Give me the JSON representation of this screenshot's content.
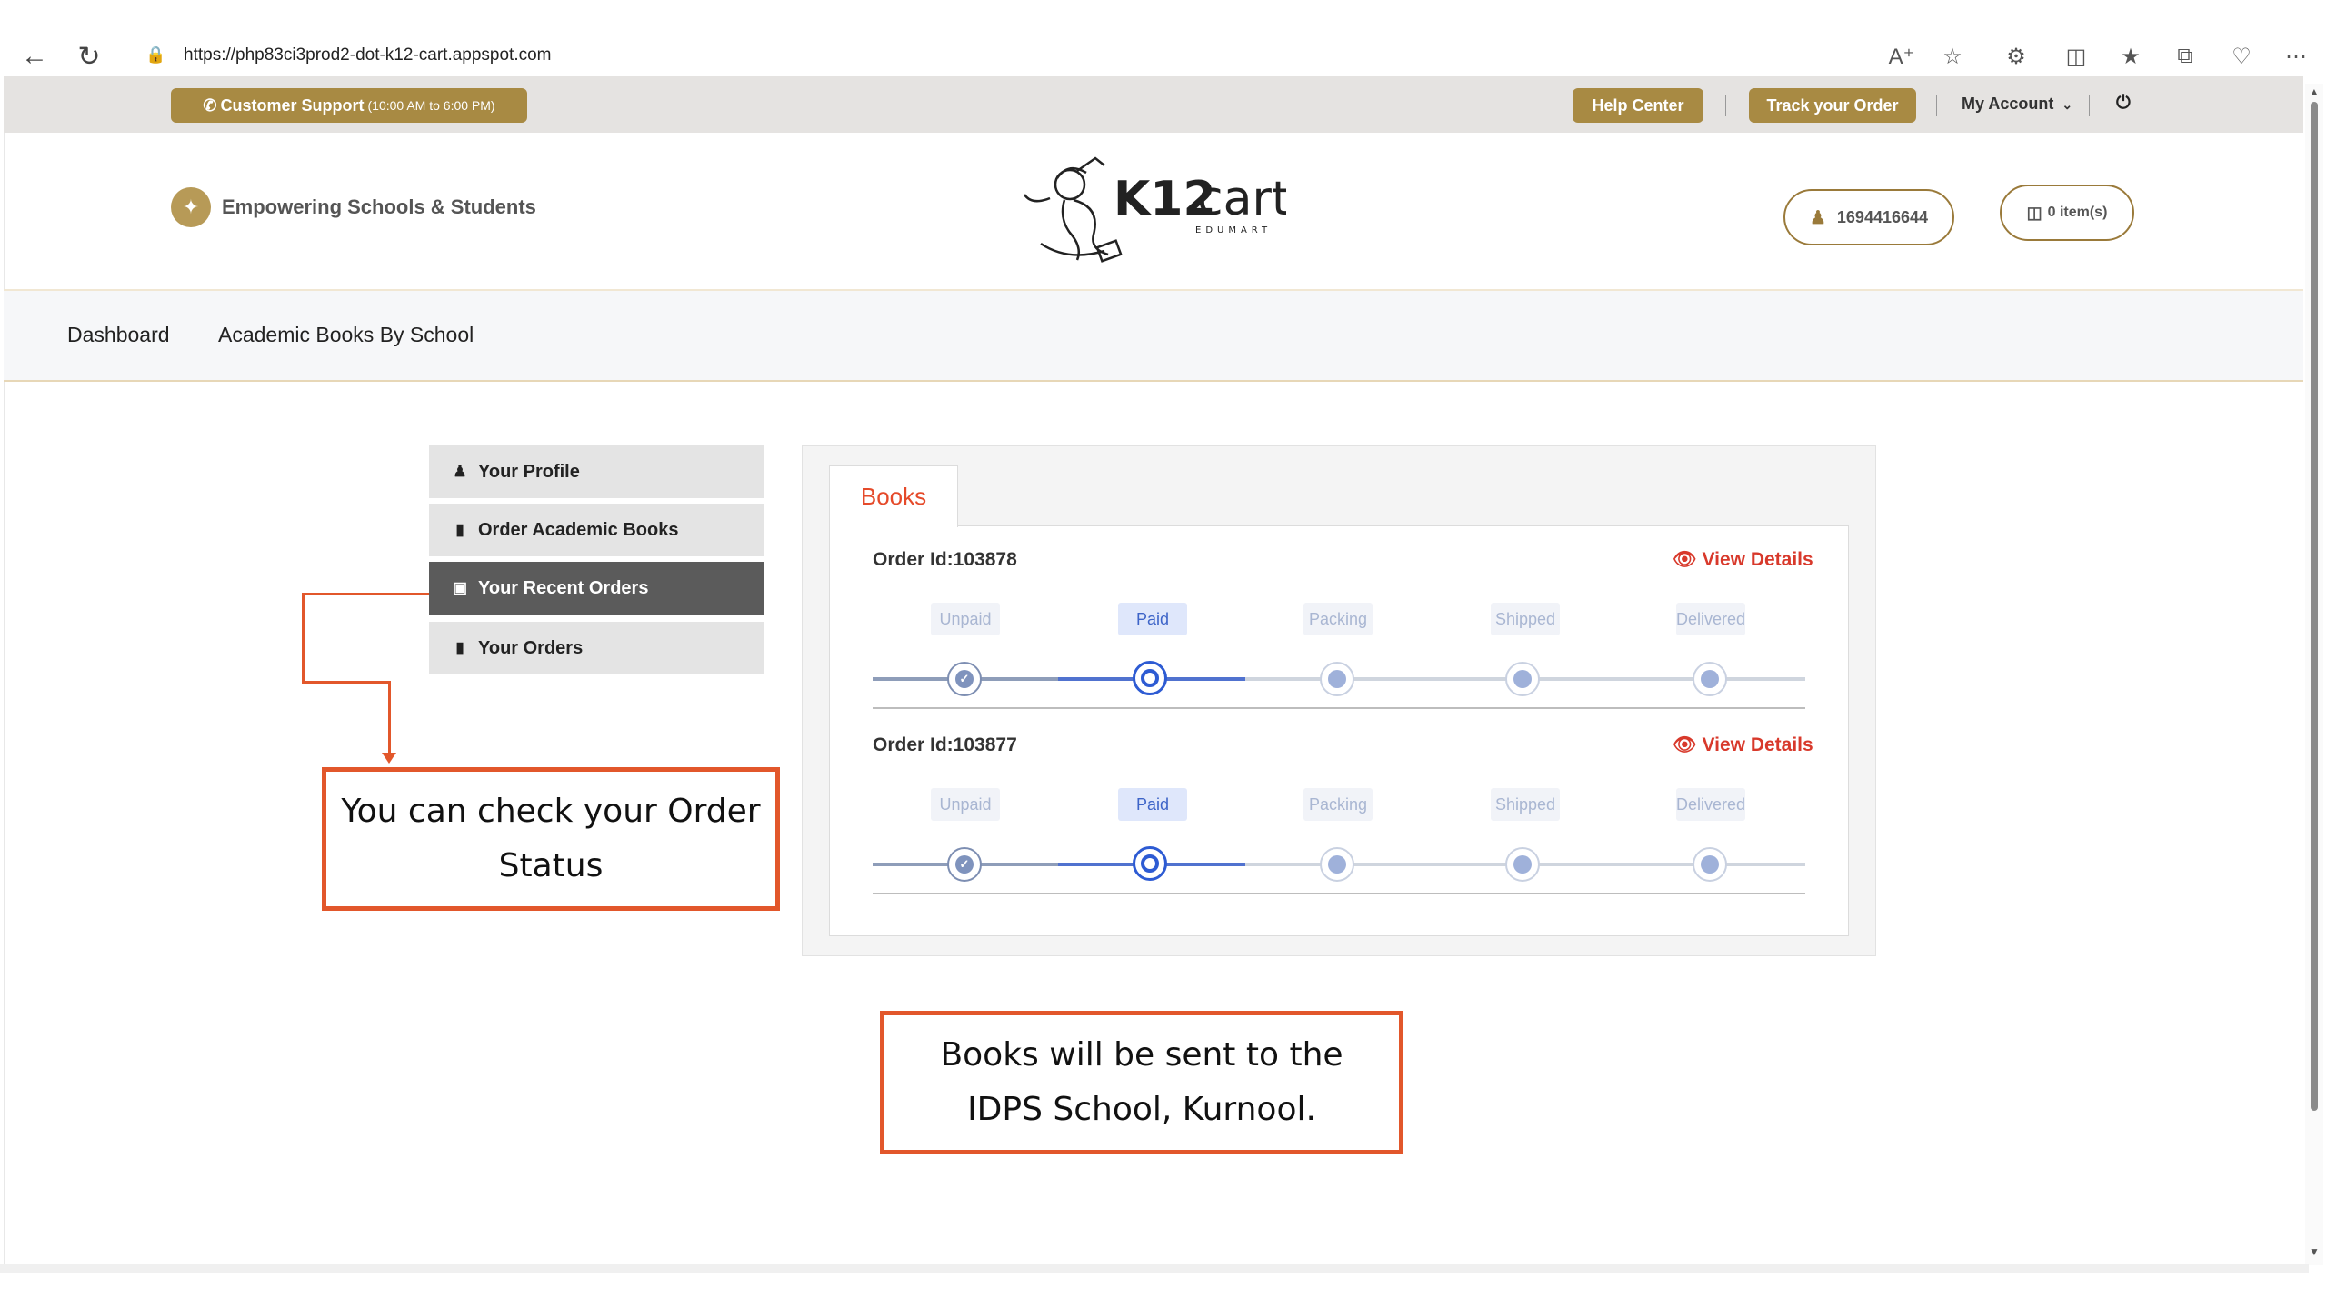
{
  "browser": {
    "url": "https://php83ci3prod2-dot-k12-cart.appspot.com"
  },
  "top_bar": {
    "support_label": "Customer Support",
    "support_hours": "(10:00 AM to 6:00 PM)",
    "help_center": "Help Center",
    "track_order": "Track your Order",
    "my_account": "My Account"
  },
  "header": {
    "tagline": "Empowering Schools & Students",
    "logo_text": "K12cart",
    "logo_sub": "EDUMART",
    "user_id": "1694416644",
    "cart": "0 item(s)"
  },
  "nav": {
    "dashboard": "Dashboard",
    "academic_books": "Academic Books By School"
  },
  "sidebar": {
    "items": [
      {
        "label": "Your Profile"
      },
      {
        "label": "Order Academic Books"
      },
      {
        "label": "Your Recent Orders"
      },
      {
        "label": "Your Orders"
      }
    ]
  },
  "orders": {
    "tab": "Books",
    "view_details": "View Details",
    "stages": [
      "Unpaid",
      "Paid",
      "Packing",
      "Shipped",
      "Delivered"
    ],
    "list": [
      {
        "id_label": "Order Id:103878",
        "current_stage": "Paid"
      },
      {
        "id_label": "Order Id:103877",
        "current_stage": "Paid"
      }
    ]
  },
  "annotations": {
    "order_status": "You can check your Order Status",
    "delivery_note": "Books will be sent to the IDPS School, Kurnool."
  },
  "colors": {
    "gold": "#a88a43",
    "accent_red": "#d8392b",
    "annotation": "#e2572b",
    "progress_blue": "#2d5bd3"
  }
}
